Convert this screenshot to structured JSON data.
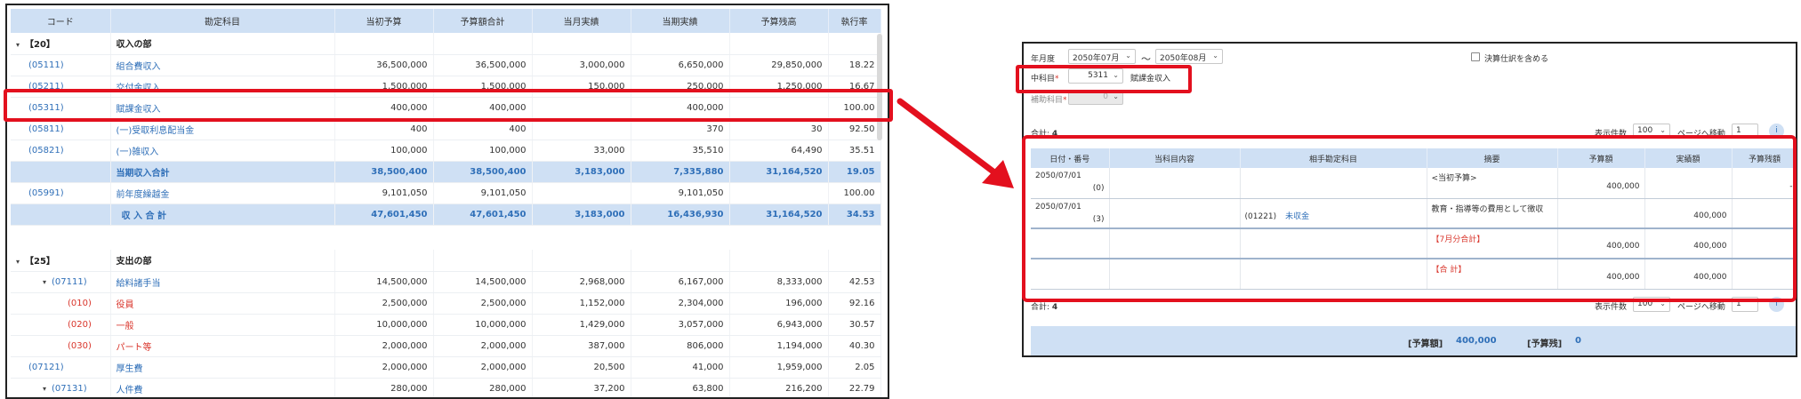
{
  "left": {
    "headers": [
      "コード",
      "勘定科目",
      "当初予算",
      "予算額合計",
      "当月実績",
      "当期実績",
      "予算残高",
      "執行率"
    ],
    "rows": [
      {
        "type": "header",
        "code": "【20】",
        "name": "収入の部",
        "v": [
          "",
          "",
          "",
          "",
          "",
          ""
        ]
      },
      {
        "type": "item",
        "code": "(05111)",
        "name": "組合費収入",
        "v": [
          "36,500,000",
          "36,500,000",
          "3,000,000",
          "6,650,000",
          "29,850,000",
          "18.22"
        ]
      },
      {
        "type": "item",
        "code": "(05211)",
        "name": "交付金収入",
        "v": [
          "1,500,000",
          "1,500,000",
          "150,000",
          "250,000",
          "1,250,000",
          "16.67"
        ]
      },
      {
        "type": "item",
        "code": "(05311)",
        "name": "賦課金収入",
        "v": [
          "400,000",
          "400,000",
          "",
          "400,000",
          "",
          "100.00"
        ]
      },
      {
        "type": "item",
        "code": "(05811)",
        "name": "(一)受取利息配当金",
        "v": [
          "400",
          "400",
          "",
          "370",
          "30",
          "92.50"
        ]
      },
      {
        "type": "item",
        "code": "(05821)",
        "name": "(一)雑収入",
        "v": [
          "100,000",
          "100,000",
          "33,000",
          "35,510",
          "64,490",
          "35.51"
        ]
      },
      {
        "type": "subtotal",
        "code": "",
        "name": "当期収入合計",
        "v": [
          "38,500,400",
          "38,500,400",
          "3,183,000",
          "7,335,880",
          "31,164,520",
          "19.05"
        ]
      },
      {
        "type": "item",
        "code": "(05991)",
        "name": "前年度繰越金",
        "v": [
          "9,101,050",
          "9,101,050",
          "",
          "9,101,050",
          "",
          "100.00"
        ]
      },
      {
        "type": "subtotal",
        "code": "",
        "name": "収 入 合 計",
        "v": [
          "47,601,450",
          "47,601,450",
          "3,183,000",
          "16,436,930",
          "31,164,520",
          "34.53"
        ]
      },
      {
        "type": "spacer"
      },
      {
        "type": "header",
        "code": "【25】",
        "name": "支出の部",
        "v": [
          "",
          "",
          "",
          "",
          "",
          ""
        ]
      },
      {
        "type": "item",
        "code": "(07111)",
        "name": "給料諸手当",
        "v": [
          "14,500,000",
          "14,500,000",
          "2,968,000",
          "6,167,000",
          "8,333,000",
          "42.53"
        ]
      },
      {
        "type": "red",
        "code": "(010)",
        "name": "役員",
        "v": [
          "2,500,000",
          "2,500,000",
          "1,152,000",
          "2,304,000",
          "196,000",
          "92.16"
        ]
      },
      {
        "type": "red",
        "code": "(020)",
        "name": "一般",
        "v": [
          "10,000,000",
          "10,000,000",
          "1,429,000",
          "3,057,000",
          "6,943,000",
          "30.57"
        ]
      },
      {
        "type": "red",
        "code": "(030)",
        "name": "パート等",
        "v": [
          "2,000,000",
          "2,000,000",
          "387,000",
          "806,000",
          "1,194,000",
          "40.30"
        ]
      },
      {
        "type": "item",
        "code": "(07121)",
        "name": "厚生費",
        "v": [
          "2,000,000",
          "2,000,000",
          "20,500",
          "41,000",
          "1,959,000",
          "2.05"
        ]
      },
      {
        "type": "item",
        "code": "(07131)",
        "name": "人件費",
        "v": [
          "280,000",
          "280,000",
          "37,200",
          "63,800",
          "216,200",
          "22.79"
        ]
      }
    ]
  },
  "right": {
    "period_label": "年月度",
    "period_from": "2050年07月",
    "tilde": "～",
    "period_to": "2050年08月",
    "settlement_label": "決算仕訳を含める",
    "mid_account_label": "中科目",
    "req_mark": "*",
    "mid_account_code": "5311",
    "mid_account_name": "賦課金収入",
    "sub_account_label": "補助科目",
    "sub_account_value": "0",
    "total_count_label": "合計:",
    "total_count": "4",
    "display_count_label": "表示件数",
    "display_count": "100",
    "page_move_label": "ページへ移動",
    "page_value": "1",
    "help": "i",
    "headers": [
      "日付・番号",
      "当科目内容",
      "相手勘定科目",
      "摘要",
      "予算額",
      "実績額",
      "予算残額"
    ],
    "rows": [
      {
        "date": "2050/07/01",
        "no": "(0)",
        "partner_code": "",
        "partner_name": "",
        "summary": "<当初予算>",
        "budget": "400,000",
        "actual": "",
        "remaining": "-",
        "summary_red": false
      },
      {
        "date": "2050/07/01",
        "no": "(3)",
        "partner_code": "(01221)",
        "partner_name": "未収金",
        "summary": "教育・指導等の費用として徴収",
        "budget": "",
        "actual": "400,000",
        "remaining": "",
        "summary_red": false
      },
      {
        "date": "",
        "no": "",
        "partner_code": "",
        "partner_name": "",
        "summary": "【7月分合計】",
        "budget": "400,000",
        "actual": "400,000",
        "remaining": "",
        "summary_red": true
      },
      {
        "date": "",
        "no": "",
        "partner_code": "",
        "partner_name": "",
        "summary": "【合 計】",
        "budget": "400,000",
        "actual": "400,000",
        "remaining": "",
        "summary_red": true
      }
    ],
    "footer_budget_label": "[予算額]",
    "footer_budget_value": "400,000",
    "footer_remaining_label": "[予算残]",
    "footer_remaining_value": "0"
  },
  "colors": {
    "header_bg": "#cfe0f4",
    "link": "#2f6fb8",
    "red": "#d9352b",
    "highlight": "#e3101e"
  }
}
